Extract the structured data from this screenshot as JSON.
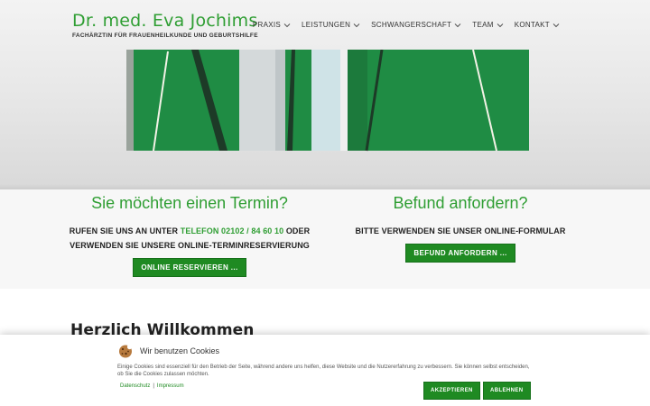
{
  "brand": {
    "name": "Dr. med. Eva Jochims",
    "subtitle": "FACHÄRZTIN FÜR FRAUENHEILKUNDE UND GEBURTSHILFE"
  },
  "nav": {
    "items": [
      {
        "label": "PRAXIS",
        "icon": "chevron-down-icon"
      },
      {
        "label": "LEISTUNGEN",
        "icon": "chevron-down-icon"
      },
      {
        "label": "SCHWANGERSCHAFT",
        "icon": "chevron-down-icon"
      },
      {
        "label": "TEAM",
        "icon": "chevron-down-icon"
      },
      {
        "label": "KONTAKT",
        "icon": "chevron-down-icon"
      }
    ]
  },
  "appointment": {
    "title": "Sie möchten einen Termin?",
    "line1_prefix": "RUFEN SIE UNS AN UNTER ",
    "phone": "TELEFON 02102 / 84 60 10",
    "line1_suffix": " ODER",
    "line2": "VERWENDEN SIE UNSERE ONLINE-TERMINRESERVIERUNG",
    "button_label": "ONLINE RESERVIEREN ..."
  },
  "findings": {
    "title": "Befund anfordern?",
    "text": "BITTE VERWENDEN SIE UNSER ONLINE-FORMULAR",
    "button_label": "BEFUND ANFORDERN ..."
  },
  "welcome": {
    "heading": "Herzlich Willkommen"
  },
  "cookie_banner": {
    "icon": "cookie-icon",
    "title": "Wir benutzen Cookies",
    "description": "Einige Cookies sind essenziell für den Betrieb der Seite, während andere uns helfen, diese Website und die Nutzererfahrung zu verbessern. Sie können selbst entscheiden, ob Sie die Cookies zulassen möchten.",
    "link_privacy": "Datenschutz",
    "link_separator": "|",
    "link_imprint": "Impressum",
    "accept_label": "AKZEPTIEREN",
    "decline_label": "ABLEHNEN"
  },
  "colors": {
    "accent_green": "#2f9e33",
    "button_green": "#1f8a22",
    "artwork_green": "#1f8c44"
  }
}
